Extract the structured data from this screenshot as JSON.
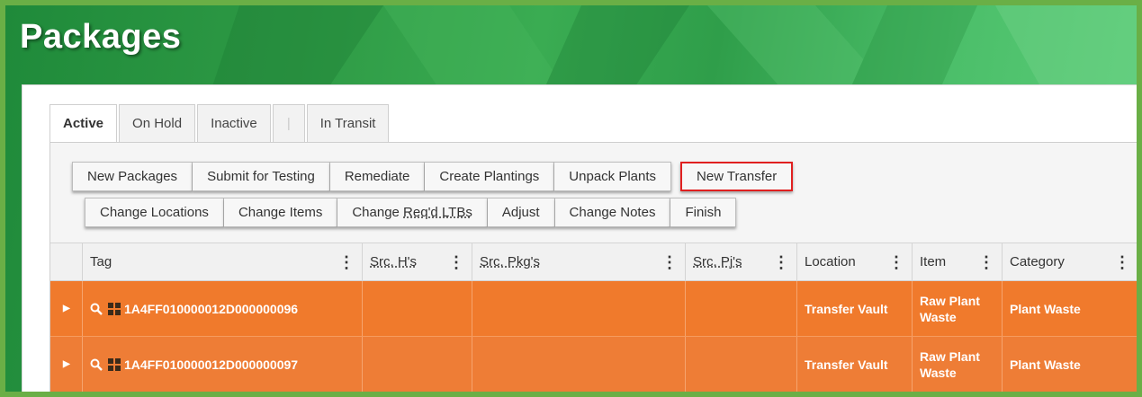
{
  "page": {
    "title": "Packages"
  },
  "tabs": [
    {
      "label": "Active"
    },
    {
      "label": "On Hold"
    },
    {
      "label": "Inactive"
    },
    {
      "label": ""
    },
    {
      "label": "In Transit"
    }
  ],
  "toolbar": {
    "row1": [
      "New Packages",
      "Submit for Testing",
      "Remediate",
      "Create Plantings",
      "Unpack Plants"
    ],
    "highlighted": "New Transfer",
    "row2": [
      "Change Locations",
      "Change Items",
      "Change Req'd LTBs",
      "Adjust",
      "Change Notes",
      "Finish"
    ]
  },
  "grid": {
    "columns": [
      "Tag",
      "Src. H's",
      "Src. Pkg's",
      "Src. Pj's",
      "Location",
      "Item",
      "Category"
    ],
    "rows": [
      {
        "tag": "1A4FF010000012D000000096",
        "src_h": "",
        "src_pkg": "",
        "src_pj": "",
        "location": "Transfer Vault",
        "item": "Raw Plant Waste",
        "category": "Plant Waste"
      },
      {
        "tag": "1A4FF010000012D000000097",
        "src_h": "",
        "src_pkg": "",
        "src_pj": "",
        "location": "Transfer Vault",
        "item": "Raw Plant Waste",
        "category": "Plant Waste"
      }
    ]
  },
  "colors": {
    "row_orange": "#f07a2c",
    "highlight_border": "#e02020",
    "header_green": "#2e9a45"
  },
  "icons": {
    "expander": "triangle-right-icon",
    "search": "magnifier-icon",
    "grid": "grid-icon",
    "column_menu": "vertical-dots-icon"
  }
}
